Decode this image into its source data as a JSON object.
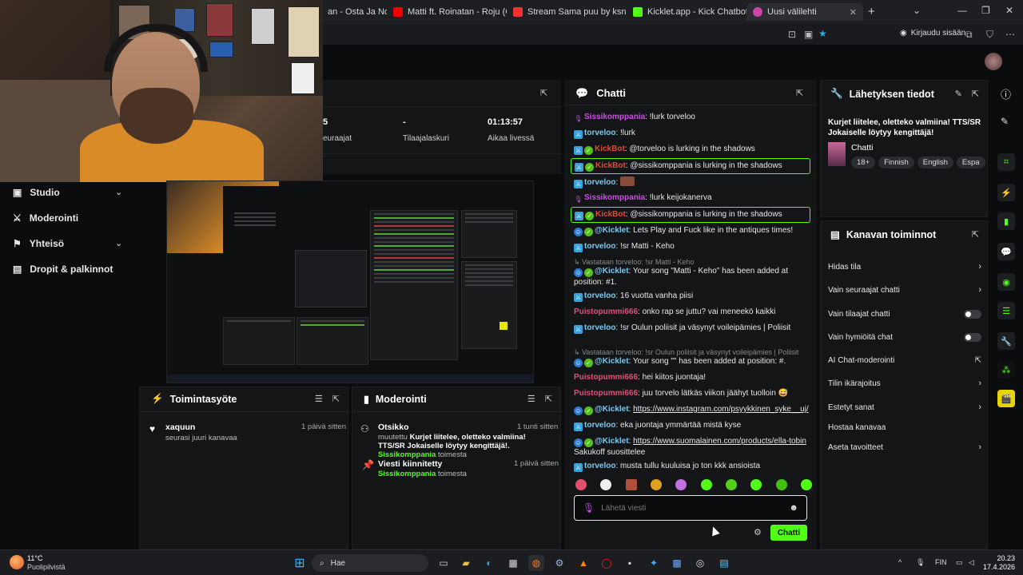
{
  "browser": {
    "tabs": [
      {
        "label": "an - Osta Ja Noi",
        "favicon_color": "#d33"
      },
      {
        "label": "Matti ft. Roinatan - Roju (Officia",
        "favicon_color": "#e00"
      },
      {
        "label": "Stream Sama puu by ksnMiihuel",
        "favicon_color": "#e33"
      },
      {
        "label": "Kicklet.app - Kick Chatbot and C",
        "favicon_color": "#53fc18"
      },
      {
        "label": "Uusi välilehti",
        "favicon_color": "#c4a"
      }
    ],
    "login_label": "Kirjaudu sisään"
  },
  "stats": [
    {
      "value": "5",
      "label": "euraajat"
    },
    {
      "value": "-",
      "label": "Tilaajalaskuri"
    },
    {
      "value": "01:13:57",
      "label": "Aikaa livessä"
    }
  ],
  "nav": [
    {
      "label": "Studio",
      "icon": "studio-icon",
      "chevron": true
    },
    {
      "label": "Moderointi",
      "icon": "sword-icon",
      "chevron": false
    },
    {
      "label": "Yhteisö",
      "icon": "community-icon",
      "chevron": true
    },
    {
      "label": "Dropit & palkinnot",
      "icon": "gift-icon",
      "chevron": false
    }
  ],
  "activity": {
    "title": "Toimintasyöte",
    "items": [
      {
        "name": "xaquun",
        "text": "seurasi juuri kanavaa",
        "when": "1 päivä sitten"
      }
    ]
  },
  "moderation": {
    "title": "Moderointi",
    "items": [
      {
        "title": "Otsikko",
        "when": "1 tunti sitten",
        "prefix": "muutettu",
        "value": "Kurjet liitelee, oletteko valmiina! TTS/SR Jokaiselle löytyy kengittäjä!.",
        "actor": "Sissikomppania",
        "suffix": "toimesta"
      },
      {
        "title": "Viesti kiinnitetty",
        "when": "1 päivä sitten",
        "actor": "Sissikomppania",
        "suffix": "toimesta"
      }
    ]
  },
  "chat": {
    "title": "Chatti",
    "messages": [
      {
        "user": "Sissikomppania",
        "color": "#c84fe0",
        "badges": [
          "mic"
        ],
        "text": ": !lurk torveloo"
      },
      {
        "user": "torveloo",
        "color": "#7cc8f0",
        "badges": [
          "mod"
        ],
        "text": ": !lurk"
      },
      {
        "user": "KickBot",
        "color": "#e04a3a",
        "badges": [
          "mod",
          "vip"
        ],
        "text": ": @torveloo is lurking in the shadows"
      },
      {
        "user": "KickBot",
        "color": "#e04a3a",
        "badges": [
          "mod",
          "vip"
        ],
        "text": ": @sissikomppania is lurking in the shadows",
        "highlight": true
      },
      {
        "user": "torveloo",
        "color": "#7cc8f0",
        "badges": [
          "mod"
        ],
        "text": ":",
        "emote": true
      },
      {
        "user": "Sissikomppania",
        "color": "#c84fe0",
        "badges": [
          "mic"
        ],
        "text": ": !lurk keijokanerva"
      },
      {
        "user": "KickBot",
        "color": "#e04a3a",
        "badges": [
          "mod",
          "vip"
        ],
        "text": ": @sissikomppania is lurking in the shadows",
        "highlight": true
      },
      {
        "user": "@Kicklet",
        "color": "#7cc8f0",
        "badges": [
          "bot",
          "vip"
        ],
        "text": ": Lets Play and Fuck like in the antiques times!"
      },
      {
        "user": "torveloo",
        "color": "#7cc8f0",
        "badges": [
          "mod"
        ],
        "text": ": !sr Matti - Keho"
      },
      {
        "reply": "Vastataan torveloo: !sr Matti - Keho",
        "user": "@Kicklet",
        "color": "#7cc8f0",
        "badges": [
          "bot",
          "vip"
        ],
        "text": ": Your song \"Matti - Keho\" has been added at position: #1."
      },
      {
        "user": "torveloo",
        "color": "#7cc8f0",
        "badges": [
          "mod"
        ],
        "text": ": 16 vuotta vanha piisi"
      },
      {
        "user": "Puistopummi666",
        "color": "#e0507a",
        "badges": [],
        "text": ": onko rap se juttu? vai meneekö kaikki"
      },
      {
        "user": "torveloo",
        "color": "#7cc8f0",
        "badges": [
          "mod"
        ],
        "text": ": !sr Oulun poliisit ja väsynyt voileipämies | Poliisit"
      },
      {
        "reply": "Vastataan torveloo: !sr Oulun poliisit ja väsynyt voileipämies | Poliisit",
        "user": "@Kicklet",
        "color": "#7cc8f0",
        "badges": [
          "bot",
          "vip"
        ],
        "text": ": Your song \"\" has been added at position: #."
      },
      {
        "user": "Puistopummi666",
        "color": "#e0507a",
        "badges": [],
        "text": ": hei kiitos juontaja!"
      },
      {
        "user": "Puistopummi666",
        "color": "#e0507a",
        "badges": [],
        "text": ": juu torvelo lätkäs viikon jäähyt tuolloin 😅"
      },
      {
        "user": "@Kicklet",
        "color": "#7cc8f0",
        "badges": [
          "bot",
          "vip"
        ],
        "text": ": ",
        "link": "https://www.instagram.com/psyykkinen_syke__uj/"
      },
      {
        "user": "torveloo",
        "color": "#7cc8f0",
        "badges": [
          "mod"
        ],
        "text": ": eka juontaja ymmärtää mistä kyse"
      },
      {
        "user": "@Kicklet",
        "color": "#7cc8f0",
        "badges": [
          "bot",
          "vip"
        ],
        "text": ": ",
        "link": "https://www.suomalainen.com/products/ella-tobin",
        "after": "Sakukoff suosittelee"
      },
      {
        "user": "torveloo",
        "color": "#7cc8f0",
        "badges": [
          "mod"
        ],
        "text": ": musta tullu kuuluisa jo ton kkk ansioista"
      }
    ],
    "input_placeholder": "Lähetä viesti",
    "send_label": "Chatti"
  },
  "stream_info": {
    "title": "Lähetyksen tiedot",
    "stream_title": "Kurjet liitelee, oletteko valmiina! TTS/SR Jokaiselle löytyy kengittäjä!",
    "category": "Chatti",
    "tags": [
      "18+",
      "Finnish",
      "English",
      "Espa"
    ]
  },
  "channel_actions": {
    "title": "Kanavan toiminnot",
    "items": [
      {
        "label": "Hidas tila",
        "control": "chevron"
      },
      {
        "label": "Vain seuraajat chatti",
        "control": "chevron"
      },
      {
        "label": "Vain tilaajat chatti",
        "control": "toggle"
      },
      {
        "label": "Vain hymiöitä chat",
        "control": "toggle"
      },
      {
        "label": "AI Chat-moderointi",
        "control": "external"
      },
      {
        "label": "Tilin ikärajoitus",
        "control": "chevron"
      },
      {
        "label": "Estetyt sanat",
        "control": "chevron"
      },
      {
        "label": "Hostaa kanavaa",
        "control": "none"
      },
      {
        "label": "Aseta tavoitteet",
        "control": "chevron"
      }
    ]
  },
  "taskbar": {
    "weather_temp": "11°C",
    "weather_desc": "Puolipilvistä",
    "search_label": "Hae",
    "lang": "FIN",
    "time": "20.23",
    "date": "17.4.2026"
  },
  "colors": {
    "accent": "#53fc18",
    "panel": "#141517",
    "bg": "#0b0c0e"
  }
}
